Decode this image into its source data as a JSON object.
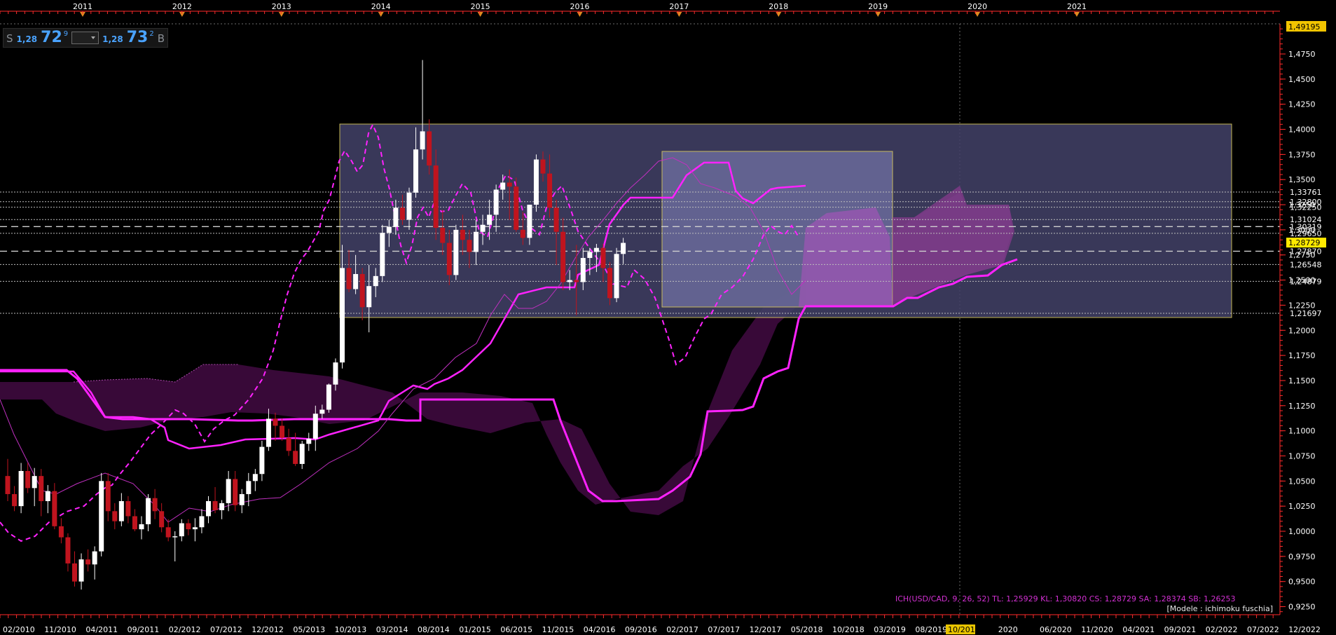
{
  "ticker": {
    "sell_side": "S",
    "sell_prefix": "1,28",
    "sell_big": "72",
    "sell_sup": "9",
    "buy_prefix": "1,28",
    "buy_big": "73",
    "buy_sup": "2",
    "buy_side": "B"
  },
  "indicator_info": "ICH(USD/CAD, 9, 26, 52)  TL: 1,25929  KL: 1,30820  CS: 1,28729  SA: 1,28374  SB: 1,26253",
  "model_label": "[Modele : ichimoku fuschia]",
  "colors": {
    "background": "#000000",
    "axis": "#ff2a2a",
    "ichimoku": "#ff22ff",
    "cloud": "#3b0a3b",
    "box_outer": "#414066",
    "box_inner": "#6a6a9a",
    "box_border": "#e0d060",
    "bull_candle": "#ffffff",
    "bear_candle": "#c0141e",
    "last_price_tag": "#ffea00"
  },
  "chart_data": {
    "type": "candlestick",
    "ylim": [
      0.917,
      1.505
    ],
    "top_axis_years": [
      "2011",
      "2012",
      "2013",
      "2014",
      "2015",
      "2016",
      "2017",
      "2018",
      "2019",
      "2020",
      "2021"
    ],
    "x_tick_labels": [
      "02/2010",
      "11/2010",
      "04/2011",
      "09/2011",
      "02/2012",
      "07/2012",
      "12/2012",
      "05/2013",
      "10/2013",
      "03/2014",
      "08/2014",
      "01/2015",
      "06/2015",
      "11/2015",
      "04/2016",
      "09/2016",
      "02/2017",
      "07/2017",
      "12/2017",
      "05/2018",
      "10/2018",
      "03/2019",
      "08/2019",
      "10/2019",
      "2020",
      "06/2020",
      "11/2020",
      "04/2021",
      "09/2021",
      "02/2022",
      "07/2022",
      "12/2022"
    ],
    "cursor_x_label": "10/2019",
    "y_tick_labels": [
      "1,4750",
      "1,4500",
      "1,4250",
      "1,4000",
      "1,3750",
      "1,3500",
      "1,3250",
      "1,3000",
      "1,2750",
      "1,2500",
      "1,2250",
      "1,2000",
      "1,1750",
      "1,1500",
      "1,1250",
      "1,1000",
      "1,0750",
      "1,0500",
      "1,0250",
      "1,0000",
      "0,9750",
      "0,9500",
      "0,9250"
    ],
    "y_ticks": [
      1.475,
      1.45,
      1.425,
      1.4,
      1.375,
      1.35,
      1.325,
      1.3,
      1.275,
      1.25,
      1.225,
      1.2,
      1.175,
      1.15,
      1.125,
      1.1,
      1.075,
      1.05,
      1.025,
      1.0,
      0.975,
      0.95,
      0.925
    ],
    "top_price_tag": "1,49195",
    "last_price_tag": "1,28729",
    "levels": [
      {
        "value": 1.33761,
        "label": "1,33761"
      },
      {
        "value": 1.328,
        "label": "1,32800"
      },
      {
        "value": 1.3225,
        "label": "1,32250"
      },
      {
        "value": 1.31024,
        "label": "1,31024"
      },
      {
        "value": 1.30319,
        "label": "1,30319"
      },
      {
        "value": 1.2965,
        "label": "1,29650"
      },
      {
        "value": 1.2787,
        "label": "1,27870"
      },
      {
        "value": 1.26548,
        "label": "1,26548"
      },
      {
        "value": 1.24879,
        "label": "1,24879"
      },
      {
        "value": 1.21697,
        "label": "1,21697"
      }
    ],
    "candles": [
      [
        1.055,
        1.072,
        1.03,
        1.037
      ],
      [
        1.037,
        1.045,
        1.02,
        1.025
      ],
      [
        1.025,
        1.068,
        1.018,
        1.06
      ],
      [
        1.06,
        1.068,
        1.038,
        1.043
      ],
      [
        1.043,
        1.063,
        1.025,
        1.055
      ],
      [
        1.055,
        1.062,
        1.015,
        1.03
      ],
      [
        1.03,
        1.046,
        1.018,
        1.04
      ],
      [
        1.04,
        1.048,
        1.002,
        1.005
      ],
      [
        1.005,
        1.013,
        0.988,
        0.994
      ],
      [
        0.994,
        0.998,
        0.96,
        0.968
      ],
      [
        0.968,
        0.98,
        0.945,
        0.95
      ],
      [
        0.95,
        0.978,
        0.942,
        0.972
      ],
      [
        0.972,
        0.982,
        0.96,
        0.967
      ],
      [
        0.967,
        0.985,
        0.952,
        0.98
      ],
      [
        0.98,
        1.058,
        0.975,
        1.05
      ],
      [
        1.05,
        1.058,
        1.01,
        1.02
      ],
      [
        1.02,
        1.028,
        1.002,
        1.01
      ],
      [
        1.01,
        1.038,
        1.005,
        1.03
      ],
      [
        1.03,
        1.035,
        1.008,
        1.015
      ],
      [
        1.015,
        1.022,
        1.0,
        1.002
      ],
      [
        1.002,
        1.015,
        0.992,
        1.007
      ],
      [
        1.007,
        1.037,
        1.0,
        1.033
      ],
      [
        1.033,
        1.042,
        1.012,
        1.02
      ],
      [
        1.02,
        1.028,
        0.999,
        1.004
      ],
      [
        1.004,
        1.012,
        0.99,
        0.994
      ],
      [
        0.994,
        1.0,
        0.97,
        0.995
      ],
      [
        0.995,
        1.012,
        0.99,
        1.008
      ],
      [
        1.008,
        1.012,
        0.996,
        1.002
      ],
      [
        1.002,
        1.013,
        0.99,
        1.004
      ],
      [
        1.004,
        1.022,
        0.998,
        1.015
      ],
      [
        1.015,
        1.035,
        1.008,
        1.03
      ],
      [
        1.03,
        1.044,
        1.018,
        1.021
      ],
      [
        1.021,
        1.031,
        1.012,
        1.028
      ],
      [
        1.028,
        1.06,
        1.02,
        1.052
      ],
      [
        1.052,
        1.06,
        1.02,
        1.026
      ],
      [
        1.026,
        1.042,
        1.018,
        1.037
      ],
      [
        1.037,
        1.058,
        1.025,
        1.05
      ],
      [
        1.05,
        1.062,
        1.04,
        1.057
      ],
      [
        1.057,
        1.09,
        1.05,
        1.084
      ],
      [
        1.084,
        1.122,
        1.08,
        1.112
      ],
      [
        1.112,
        1.118,
        1.09,
        1.105
      ],
      [
        1.105,
        1.112,
        1.09,
        1.093
      ],
      [
        1.093,
        1.102,
        1.075,
        1.08
      ],
      [
        1.08,
        1.098,
        1.065,
        1.067
      ],
      [
        1.067,
        1.09,
        1.062,
        1.087
      ],
      [
        1.087,
        1.098,
        1.08,
        1.092
      ],
      [
        1.092,
        1.125,
        1.08,
        1.117
      ],
      [
        1.117,
        1.126,
        1.112,
        1.121
      ],
      [
        1.121,
        1.147,
        1.118,
        1.146
      ],
      [
        1.146,
        1.172,
        1.14,
        1.168
      ],
      [
        1.168,
        1.285,
        1.162,
        1.262
      ],
      [
        1.262,
        1.28,
        1.238,
        1.241
      ],
      [
        1.241,
        1.275,
        1.236,
        1.256
      ],
      [
        1.256,
        1.262,
        1.21,
        1.223
      ],
      [
        1.223,
        1.265,
        1.198,
        1.244
      ],
      [
        1.244,
        1.262,
        1.233,
        1.254
      ],
      [
        1.254,
        1.305,
        1.248,
        1.297
      ],
      [
        1.297,
        1.31,
        1.283,
        1.303
      ],
      [
        1.303,
        1.33,
        1.295,
        1.322
      ],
      [
        1.322,
        1.335,
        1.305,
        1.31
      ],
      [
        1.31,
        1.342,
        1.3,
        1.337
      ],
      [
        1.337,
        1.402,
        1.332,
        1.38
      ],
      [
        1.38,
        1.469,
        1.37,
        1.398
      ],
      [
        1.398,
        1.41,
        1.355,
        1.364
      ],
      [
        1.364,
        1.38,
        1.29,
        1.302
      ],
      [
        1.302,
        1.32,
        1.275,
        1.287
      ],
      [
        1.287,
        1.3,
        1.245,
        1.255
      ],
      [
        1.255,
        1.305,
        1.25,
        1.3
      ],
      [
        1.3,
        1.315,
        1.275,
        1.29
      ],
      [
        1.29,
        1.3,
        1.262,
        1.278
      ],
      [
        1.278,
        1.31,
        1.265,
        1.298
      ],
      [
        1.298,
        1.315,
        1.285,
        1.305
      ],
      [
        1.305,
        1.33,
        1.29,
        1.315
      ],
      [
        1.315,
        1.345,
        1.298,
        1.34
      ],
      [
        1.34,
        1.355,
        1.33,
        1.347
      ],
      [
        1.347,
        1.36,
        1.31,
        1.343
      ],
      [
        1.343,
        1.352,
        1.298,
        1.3
      ],
      [
        1.3,
        1.318,
        1.285,
        1.292
      ],
      [
        1.292,
        1.32,
        1.285,
        1.325
      ],
      [
        1.325,
        1.375,
        1.318,
        1.37
      ],
      [
        1.37,
        1.378,
        1.348,
        1.356
      ],
      [
        1.356,
        1.375,
        1.312,
        1.322
      ],
      [
        1.322,
        1.33,
        1.265,
        1.298
      ],
      [
        1.298,
        1.312,
        1.24,
        1.248
      ],
      [
        1.248,
        1.26,
        1.24,
        1.25
      ],
      [
        1.25,
        1.285,
        1.215,
        1.248
      ],
      [
        1.248,
        1.282,
        1.24,
        1.272
      ],
      [
        1.272,
        1.282,
        1.255,
        1.278
      ],
      [
        1.278,
        1.286,
        1.258,
        1.282
      ],
      [
        1.282,
        1.286,
        1.248,
        1.262
      ],
      [
        1.262,
        1.268,
        1.225,
        1.232
      ],
      [
        1.232,
        1.282,
        1.228,
        1.276
      ],
      [
        1.276,
        1.292,
        1.266,
        1.287
      ]
    ],
    "x_cursor_date": "10/2019"
  }
}
